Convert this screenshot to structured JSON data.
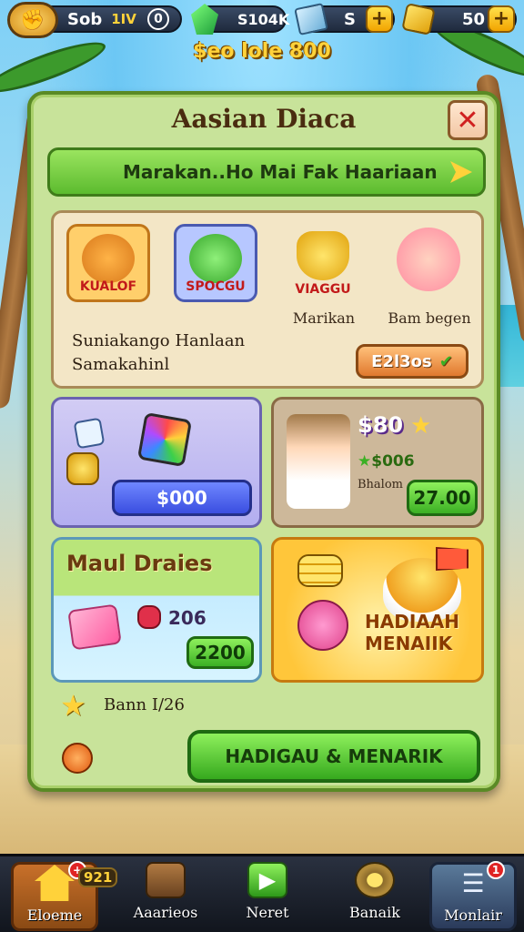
{
  "hud": {
    "player_level": "Sob",
    "player_level_num": "1IV",
    "energy": "0",
    "gems": "S104K",
    "boxes": "S",
    "gold": "50",
    "subtitle": "$eo lole 800"
  },
  "panel": {
    "title": "Aasian Diaca",
    "close_symbol": "✕",
    "banner": "Marakan..Ho Mai Fak Haariaan"
  },
  "characters": [
    {
      "badge": "KUALOF",
      "label": "",
      "color": "#ffb347"
    },
    {
      "badge": "SPOCGU",
      "label": "",
      "color": "#6fd26a"
    },
    {
      "badge": "VIAGGU",
      "label": "Marikan",
      "color": "#ffe07a"
    },
    {
      "badge": "",
      "label": "Bam begen",
      "color": "#ff9fb0"
    }
  ],
  "top_section": {
    "line1": "Suniakango  Hanlaan",
    "line2": "Samakahinl",
    "button": "E2l3os"
  },
  "mid_left": {
    "button": "$000"
  },
  "mid_right": {
    "price": "$80",
    "bonus": "$006",
    "label": "Bhalom",
    "button": "27.00"
  },
  "bot_left": {
    "title": "Maul Draies",
    "count": "206",
    "button": "2200"
  },
  "bot_right": {
    "line1": "HADIAAH",
    "line2": "MENAIIK"
  },
  "footer": {
    "note": "Bann I/26",
    "cta": "HADIGAU & MENARIK"
  },
  "nav": [
    {
      "label": "Eloeme",
      "icon": "home-icon",
      "badge": "+"
    },
    {
      "label": "Aaarieos",
      "icon": "chest-icon",
      "badge": ""
    },
    {
      "label": "Neret",
      "icon": "play-icon",
      "badge": ""
    },
    {
      "label": "Banaik",
      "icon": "gear-icon",
      "badge": ""
    },
    {
      "label": "Monlair",
      "icon": "menu-icon",
      "badge": "1"
    }
  ],
  "nav_level_badge": "921"
}
